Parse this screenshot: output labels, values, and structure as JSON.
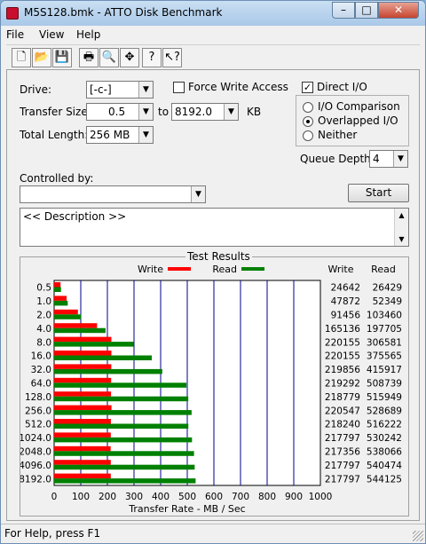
{
  "window": {
    "title": "M5S128.bmk - ATTO Disk Benchmark",
    "controls": [
      "–",
      "□",
      "✕"
    ]
  },
  "menu": [
    "File",
    "View",
    "Help"
  ],
  "toolbar": [
    {
      "name": "new-icon",
      "glyph": "🗋"
    },
    {
      "name": "open-icon",
      "glyph": "📂"
    },
    {
      "name": "save-icon",
      "glyph": "💾"
    },
    {
      "name": "print-icon",
      "glyph": "🖶"
    },
    {
      "name": "print-preview-icon",
      "glyph": "🔍"
    },
    {
      "name": "move-icon",
      "glyph": "✥"
    },
    {
      "name": "help-icon",
      "glyph": "?"
    },
    {
      "name": "context-help-icon",
      "glyph": "↖?"
    }
  ],
  "form": {
    "drive_label": "Drive:",
    "drive_value": "[-c-]",
    "force_write_label": "Force Write Access",
    "force_write_checked": false,
    "direct_io_label": "Direct I/O",
    "direct_io_checked": true,
    "transfer_size_label": "Transfer Size:",
    "transfer_from": "0.5",
    "to_label": "to",
    "transfer_to": "8192.0",
    "kb_label": "KB",
    "total_length_label": "Total Length:",
    "total_length_value": "256 MB",
    "io_options": [
      "I/O Comparison",
      "Overlapped I/O",
      "Neither"
    ],
    "io_selected": 1,
    "queue_depth_label": "Queue Depth:",
    "queue_depth_value": "4",
    "controlled_by_label": "Controlled by:",
    "controlled_by_value": "",
    "start_label": "Start",
    "description": "<< Description >>"
  },
  "results": {
    "title": "Test Results",
    "write_legend": "Write",
    "read_legend": "Read",
    "write_header": "Write",
    "read_header": "Read"
  },
  "chart_data": {
    "type": "bar",
    "orientation": "horizontal",
    "categories": [
      "0.5",
      "1.0",
      "2.0",
      "4.0",
      "8.0",
      "16.0",
      "32.0",
      "64.0",
      "128.0",
      "256.0",
      "512.0",
      "1024.0",
      "2048.0",
      "4096.0",
      "8192.0"
    ],
    "series": [
      {
        "name": "Write",
        "color": "#ff0000",
        "values": [
          24642,
          47872,
          91456,
          165136,
          220155,
          220155,
          219856,
          219292,
          218779,
          220547,
          218240,
          217797,
          217356,
          217797,
          217797
        ]
      },
      {
        "name": "Read",
        "color": "#008000",
        "values": [
          26429,
          52349,
          103460,
          197705,
          306581,
          375565,
          415917,
          508739,
          515949,
          528689,
          516222,
          530242,
          538066,
          540474,
          544125
        ]
      }
    ],
    "xlabel": "Transfer Rate - MB / Sec",
    "xlim": [
      0,
      1000
    ],
    "xticks": [
      "0",
      "100",
      "200",
      "300",
      "400",
      "500",
      "600",
      "700",
      "800",
      "900",
      "1000"
    ],
    "grid": true,
    "legend": "top"
  },
  "status": {
    "text": "For Help, press F1"
  }
}
